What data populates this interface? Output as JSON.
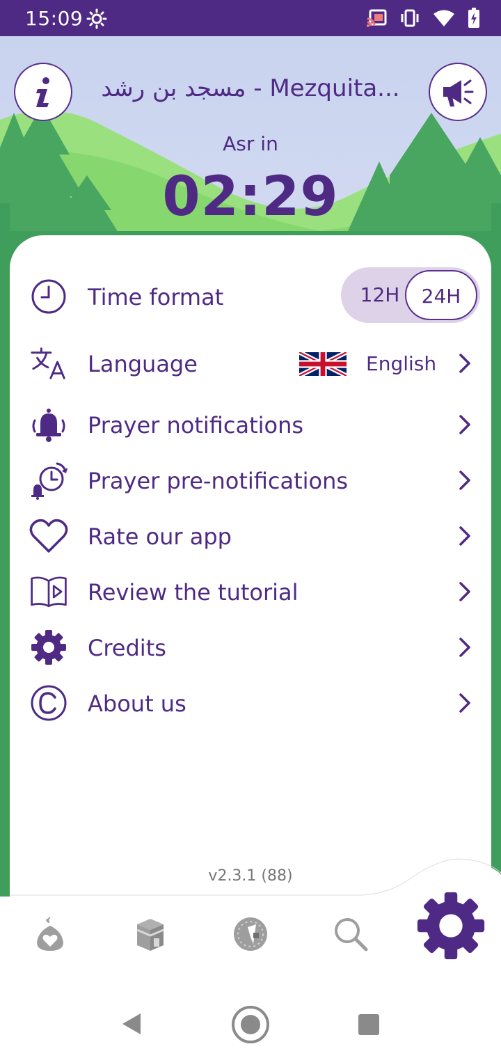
{
  "status_bar": {
    "time": "15:09",
    "icons": [
      "brightness-icon",
      "cast-icon",
      "vibrate-icon",
      "wifi-icon",
      "battery-charging-icon"
    ]
  },
  "header": {
    "info_icon": "info-icon",
    "mosque_name": "مسجد بن رشد - Mezquita...",
    "announcement_icon": "megaphone-icon",
    "next_prayer_label": "Asr in",
    "countdown": "02:29"
  },
  "settings": {
    "time_format": {
      "label": "Time format",
      "options": [
        "12H",
        "24H"
      ],
      "selected": "24H"
    },
    "language": {
      "label": "Language",
      "value": "English",
      "flag": "uk-flag-icon"
    },
    "items": [
      {
        "label": "Prayer notifications",
        "icon": "bell-ringing-icon"
      },
      {
        "label": "Prayer pre-notifications",
        "icon": "alarm-clock-bell-icon"
      },
      {
        "label": "Rate our app",
        "icon": "heart-icon"
      },
      {
        "label": "Review the tutorial",
        "icon": "book-play-icon"
      },
      {
        "label": "Credits",
        "icon": "gear-icon"
      },
      {
        "label": "About us",
        "icon": "copyright-icon"
      }
    ]
  },
  "version": "v2.3.1 (88)",
  "bottom_nav": {
    "items": [
      "mosque-heart-icon",
      "kaaba-icon",
      "qibla-compass-icon",
      "search-icon",
      "settings-gear-icon"
    ],
    "active": "settings-gear-icon"
  },
  "colors": {
    "primary": "#4f2a85",
    "toggle_bg": "#ddd2e8",
    "sky_top": "#c9d3ee",
    "grass": "#7fd36a",
    "forest": "#3f9e5b",
    "inactive_icon": "#9e9e9e"
  }
}
